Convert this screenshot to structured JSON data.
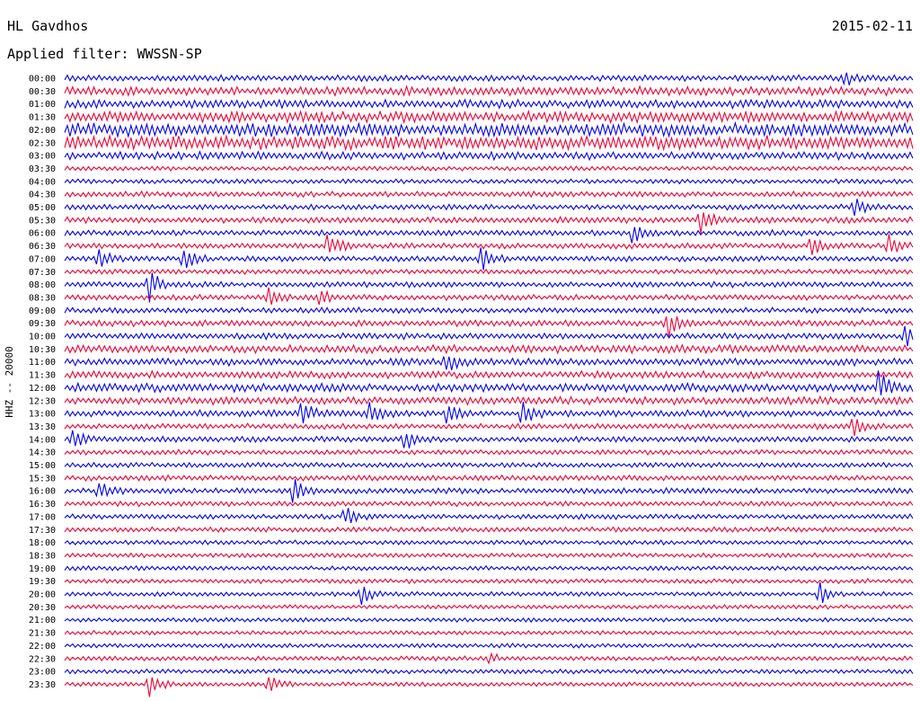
{
  "header": {
    "station": "HL Gavdhos",
    "date": "2015-02-11",
    "filter_label": "Applied filter: WWSSN-SP"
  },
  "chart_data": {
    "type": "line",
    "title": "",
    "ylabel": "HHZ -- 20000",
    "xlabel": "",
    "colors": [
      "#0000ee",
      "#ee0033"
    ],
    "row_labels": [
      "00:00",
      "00:30",
      "01:00",
      "01:30",
      "02:00",
      "02:30",
      "03:00",
      "03:30",
      "04:00",
      "04:30",
      "05:00",
      "05:30",
      "06:00",
      "06:30",
      "07:00",
      "07:30",
      "08:00",
      "08:30",
      "09:00",
      "09:30",
      "10:00",
      "10:30",
      "11:00",
      "11:30",
      "12:00",
      "12:30",
      "13:00",
      "13:30",
      "14:00",
      "14:30",
      "15:00",
      "15:30",
      "16:00",
      "16:30",
      "17:00",
      "17:30",
      "18:00",
      "18:30",
      "19:00",
      "19:30",
      "20:00",
      "20:30",
      "21:00",
      "21:30",
      "22:00",
      "22:30",
      "23:00",
      "23:30"
    ],
    "row_noise": [
      0.35,
      0.6,
      0.55,
      0.75,
      0.95,
      1.0,
      0.5,
      0.2,
      0.22,
      0.3,
      0.3,
      0.35,
      0.3,
      0.3,
      0.3,
      0.25,
      0.3,
      0.3,
      0.3,
      0.35,
      0.35,
      0.5,
      0.45,
      0.45,
      0.55,
      0.5,
      0.4,
      0.3,
      0.3,
      0.25,
      0.25,
      0.3,
      0.3,
      0.25,
      0.25,
      0.25,
      0.2,
      0.2,
      0.2,
      0.2,
      0.2,
      0.18,
      0.18,
      0.18,
      0.18,
      0.2,
      0.2,
      0.2
    ],
    "events": [
      {
        "row": 0,
        "time_frac": 0.92,
        "amp": 1.2
      },
      {
        "row": 10,
        "time_frac": 0.93,
        "amp": 2.2
      },
      {
        "row": 11,
        "time_frac": 0.75,
        "amp": 2.5
      },
      {
        "row": 12,
        "time_frac": 0.67,
        "amp": 2.0
      },
      {
        "row": 13,
        "time_frac": 0.31,
        "amp": 3.0
      },
      {
        "row": 13,
        "time_frac": 0.88,
        "amp": 2.0
      },
      {
        "row": 13,
        "time_frac": 0.97,
        "amp": 2.2
      },
      {
        "row": 14,
        "time_frac": 0.04,
        "amp": 2.5
      },
      {
        "row": 14,
        "time_frac": 0.14,
        "amp": 2.5
      },
      {
        "row": 14,
        "time_frac": 0.49,
        "amp": 3.0
      },
      {
        "row": 16,
        "time_frac": 0.1,
        "amp": 3.0
      },
      {
        "row": 17,
        "time_frac": 0.24,
        "amp": 2.5
      },
      {
        "row": 17,
        "time_frac": 0.3,
        "amp": 2.0
      },
      {
        "row": 19,
        "time_frac": 0.71,
        "amp": 3.0
      },
      {
        "row": 20,
        "time_frac": 0.99,
        "amp": 2.0
      },
      {
        "row": 22,
        "time_frac": 0.45,
        "amp": 2.0
      },
      {
        "row": 24,
        "time_frac": 0.96,
        "amp": 3.0
      },
      {
        "row": 26,
        "time_frac": 0.28,
        "amp": 2.5
      },
      {
        "row": 26,
        "time_frac": 0.36,
        "amp": 2.5
      },
      {
        "row": 26,
        "time_frac": 0.45,
        "amp": 2.0
      },
      {
        "row": 26,
        "time_frac": 0.54,
        "amp": 3.0
      },
      {
        "row": 27,
        "time_frac": 0.93,
        "amp": 2.0
      },
      {
        "row": 28,
        "time_frac": 0.01,
        "amp": 2.5
      },
      {
        "row": 28,
        "time_frac": 0.4,
        "amp": 2.5
      },
      {
        "row": 32,
        "time_frac": 0.04,
        "amp": 2.0
      },
      {
        "row": 32,
        "time_frac": 0.27,
        "amp": 2.5
      },
      {
        "row": 34,
        "time_frac": 0.33,
        "amp": 2.0
      },
      {
        "row": 40,
        "time_frac": 0.35,
        "amp": 2.0
      },
      {
        "row": 40,
        "time_frac": 0.89,
        "amp": 2.0
      },
      {
        "row": 45,
        "time_frac": 0.5,
        "amp": 1.2
      },
      {
        "row": 47,
        "time_frac": 0.1,
        "amp": 2.5
      },
      {
        "row": 47,
        "time_frac": 0.24,
        "amp": 1.8
      }
    ]
  }
}
